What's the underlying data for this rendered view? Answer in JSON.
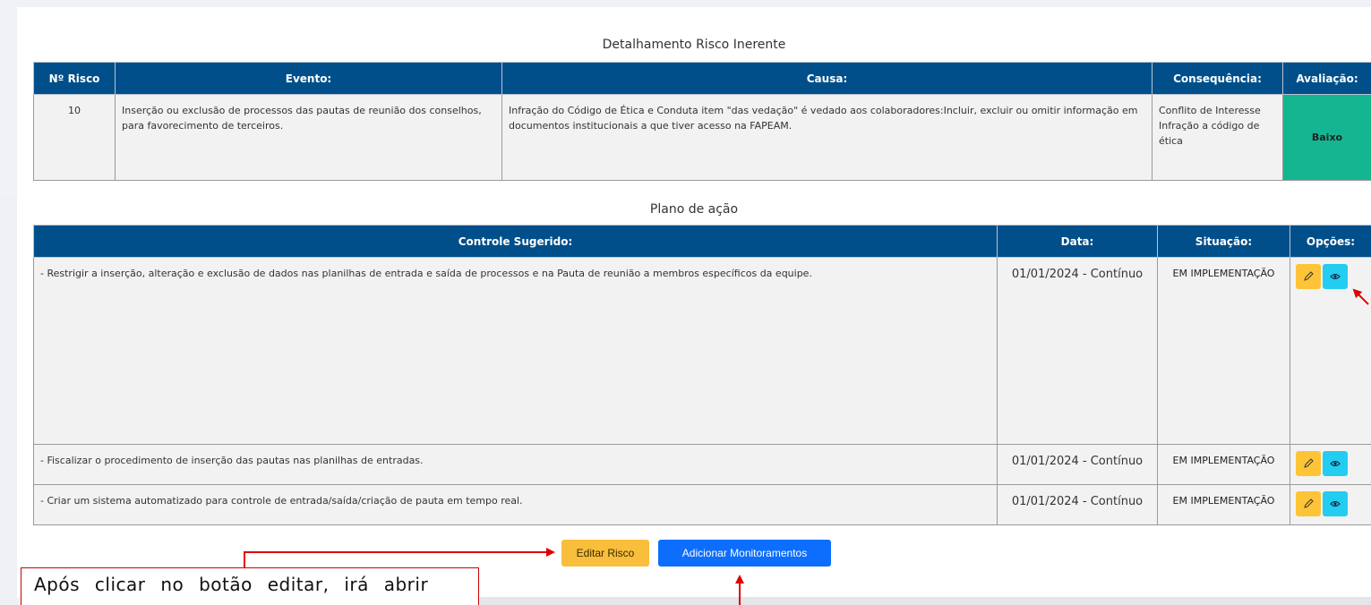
{
  "risk_section": {
    "title": "Detalhamento Risco Inerente",
    "headers": [
      "Nº Risco",
      "Evento:",
      "Causa:",
      "Consequência:",
      "Avaliação:"
    ],
    "row": {
      "numero": "10",
      "evento": "Inserção ou exclusão de processos das pautas de reunião dos conselhos, para favorecimento de terceiros.",
      "causa": "Infração do Código de Ética e Conduta item \"das vedação\"  é vedado aos colaboradores:Incluir, excluir ou omitir informação em documentos institucionais a que tiver acesso na FAPEAM.",
      "consequencia": "Conflito de Interesse Infração a código de ética",
      "avaliacao": "Baixo"
    }
  },
  "plan_section": {
    "title": "Plano de ação",
    "headers": [
      "Controle Sugerido:",
      "Data:",
      "Situação:",
      "Opções:"
    ],
    "rows": [
      {
        "controle": "- Restrigir a inserção, alteração e exclusão de dados nas planilhas de entrada e saída de processos e na Pauta de reunião a membros específicos da equipe.",
        "data": "01/01/2024 - Contínuo",
        "situacao": "EM IMPLEMENTAÇÃO"
      },
      {
        "controle": "- Fiscalizar o procedimento de inserção das pautas nas planilhas de entradas.",
        "data": "01/01/2024 - Contínuo",
        "situacao": "EM IMPLEMENTAÇÃO"
      },
      {
        "controle": "- Criar um sistema automatizado para  controle de entrada/saída/criação de pauta em tempo real.",
        "data": "01/01/2024 - Contínuo",
        "situacao": "EM IMPLEMENTAÇÃO"
      }
    ]
  },
  "buttons": {
    "editar_risco": "Editar Risco",
    "adicionar_monitoramentos": "Adicionar Monitoramentos"
  },
  "callout": {
    "text": "Após clicar no botão editar, irá abrir"
  },
  "icons": {
    "edit": "pencil-icon",
    "view": "eye-icon"
  },
  "colors": {
    "header_bg": "#004f8a",
    "avaliacao_baixo": "#14b591",
    "edit_button": "#fdc437",
    "view_button": "#22cdf0",
    "primary_button": "#0d6efd",
    "annotation": "#e00000"
  }
}
